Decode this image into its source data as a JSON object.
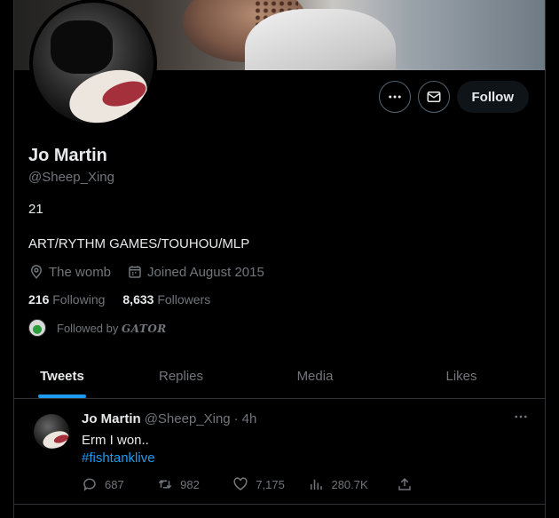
{
  "profile": {
    "name": "Jo Martin",
    "handle": "@Sheep_Xing",
    "bio_line1": "21",
    "bio_line2": "ART/RYTHM GAMES/TOUHOU/MLP",
    "location": "The womb",
    "joined": "Joined August 2015",
    "following_count": "216",
    "following_label": "Following",
    "followers_count": "8,633",
    "followers_label": "Followers",
    "followed_by_prefix": "Followed by",
    "followed_by_name": "GATOR"
  },
  "actions": {
    "more_icon": "more-icon",
    "message_icon": "mail-icon",
    "follow_label": "Follow"
  },
  "tabs": [
    {
      "label": "Tweets",
      "active": true
    },
    {
      "label": "Replies",
      "active": false
    },
    {
      "label": "Media",
      "active": false
    },
    {
      "label": "Likes",
      "active": false
    }
  ],
  "tweet": {
    "name": "Jo Martin",
    "handle": "@Sheep_Xing",
    "separator": "·",
    "time": "4h",
    "text": "Erm I won..",
    "hashtag": "#fishtanklive",
    "replies": "687",
    "retweets": "982",
    "likes": "7,175",
    "views": "280.7K"
  },
  "colors": {
    "background": "#000000",
    "accent": "#1d9bf0",
    "text_primary": "#e7e9ea",
    "text_secondary": "#71767b",
    "border": "#2f3336"
  }
}
